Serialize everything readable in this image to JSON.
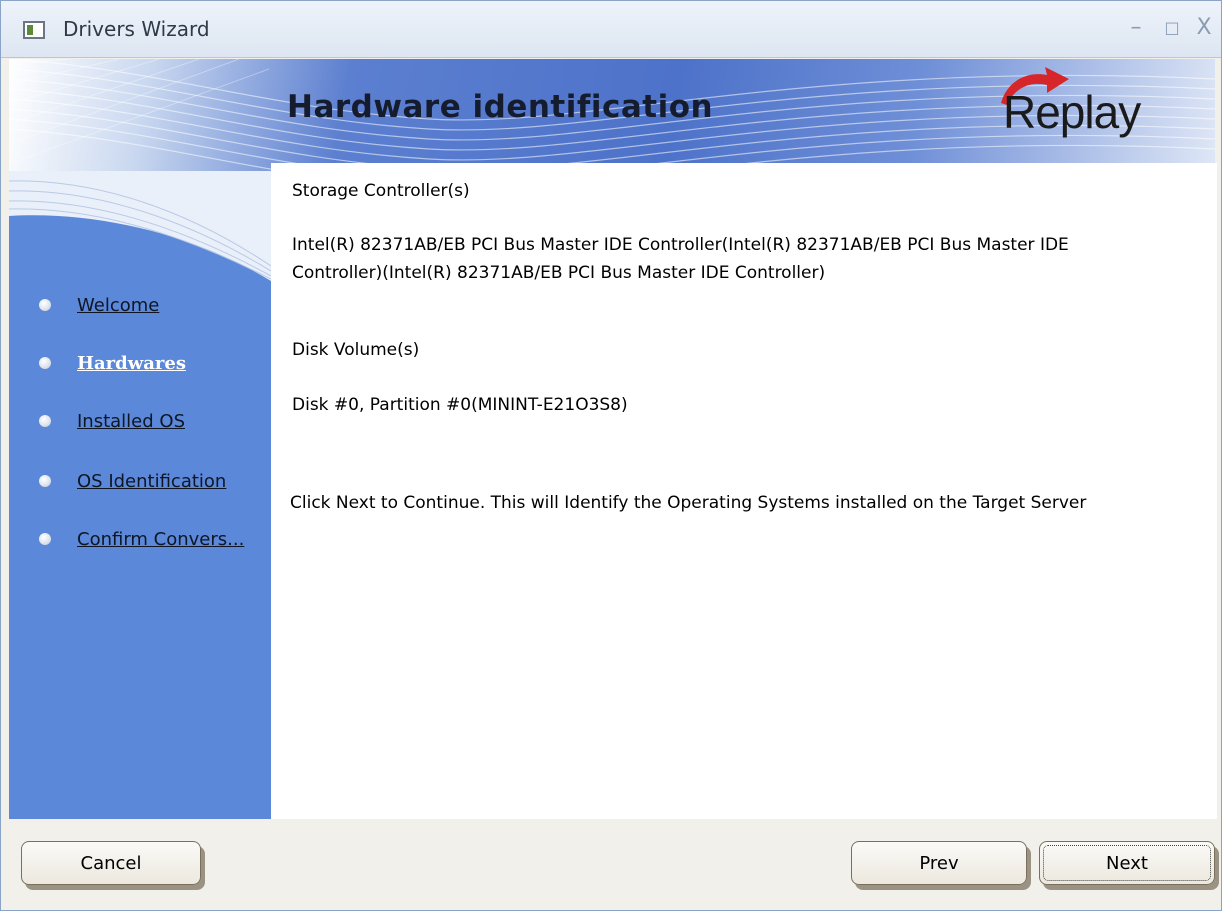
{
  "window": {
    "title": "Drivers Wizard",
    "controls": {
      "minimize": "–",
      "maximize": "□",
      "close": "X"
    }
  },
  "header": {
    "title": "Hardware identification",
    "logo": "Replay"
  },
  "sidebar": {
    "items": [
      {
        "label": "Welcome",
        "active": false
      },
      {
        "label": "Hardwares",
        "active": true
      },
      {
        "label": "Installed OS",
        "active": false
      },
      {
        "label": "OS Identification",
        "active": false
      },
      {
        "label": "Confirm Convers...",
        "active": false
      }
    ]
  },
  "content": {
    "storage_heading": "Storage Controller(s)",
    "storage_line1": "Intel(R) 82371AB/EB PCI Bus Master IDE Controller(Intel(R) 82371AB/EB PCI Bus Master IDE",
    "storage_line2": "Controller)(Intel(R) 82371AB/EB PCI Bus Master IDE Controller)",
    "disk_heading": "Disk Volume(s)",
    "disk_value": "Disk #0, Partition #0(MININT-E21O3S8)",
    "instruction": "Click Next to Continue. This will Identify the Operating Systems installed on the Target Server"
  },
  "buttons": {
    "cancel": "Cancel",
    "prev": "Prev",
    "next": "Next"
  },
  "colors": {
    "sidebar": "#5b88d8",
    "header_blue": "#4d72c9",
    "logo_arrow": "#d6262a",
    "active_nav": "#ffffff"
  },
  "icons": {
    "nav_bullet": "bullet-icon",
    "app": "app-window-icon"
  }
}
